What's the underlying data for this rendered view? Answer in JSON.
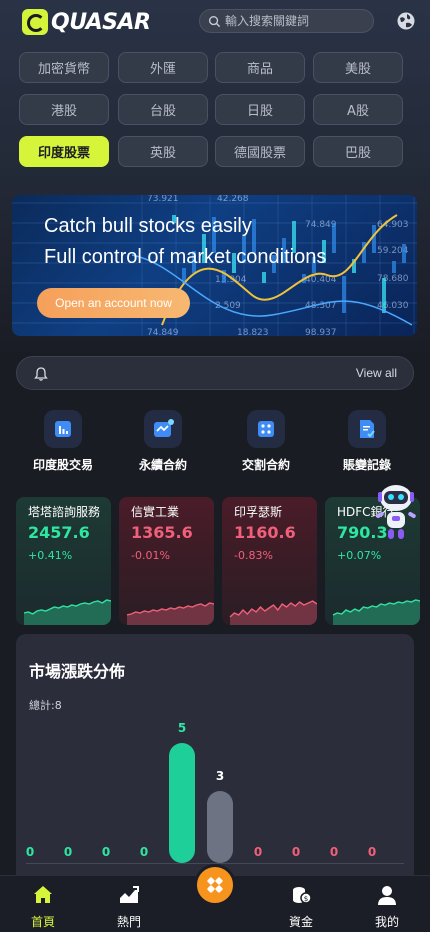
{
  "header": {
    "logo_text": "QUASAR",
    "search_placeholder": "輸入搜索關鍵詞"
  },
  "categories": [
    {
      "label": "加密貨幣",
      "active": false
    },
    {
      "label": "外匯",
      "active": false
    },
    {
      "label": "商品",
      "active": false
    },
    {
      "label": "美股",
      "active": false
    },
    {
      "label": "港股",
      "active": false
    },
    {
      "label": "台股",
      "active": false
    },
    {
      "label": "日股",
      "active": false
    },
    {
      "label": "A股",
      "active": false
    },
    {
      "label": "印度股票",
      "active": true
    },
    {
      "label": "英股",
      "active": false
    },
    {
      "label": "德國股票",
      "active": false
    },
    {
      "label": "巴股",
      "active": false
    }
  ],
  "banner": {
    "line1": "Catch bull stocks easily",
    "line2": "Full control of market conditions",
    "cta": "Open an account now",
    "bg_numbers": [
      "73.921",
      "42.268",
      "64.903",
      "74.849",
      "59.204",
      "40.404",
      "78.680",
      "13.904",
      "2.509",
      "48.307",
      "46.030",
      "74.849",
      "18.823",
      "98.937"
    ]
  },
  "notice": {
    "view_all": "View all"
  },
  "quick_actions": [
    {
      "label": "印度股交易",
      "icon": "chart-bar-icon"
    },
    {
      "label": "永續合約",
      "icon": "trend-icon"
    },
    {
      "label": "交割合約",
      "icon": "dice-icon"
    },
    {
      "label": "賬變記錄",
      "icon": "record-icon"
    }
  ],
  "stock_cards": [
    {
      "name": "塔塔諮詢服務",
      "price": "2457.6",
      "change": "+0.41%",
      "trend": "up",
      "spark": [
        18,
        17,
        19,
        16,
        15,
        16,
        14,
        12,
        13,
        11,
        12,
        10,
        11,
        9,
        8,
        9,
        7,
        6,
        8,
        5,
        6
      ]
    },
    {
      "name": "信實工業",
      "price": "1365.6",
      "change": "-0.01%",
      "trend": "down",
      "spark": [
        20,
        19,
        17,
        18,
        16,
        17,
        15,
        16,
        14,
        15,
        13,
        14,
        12,
        13,
        11,
        12,
        10,
        9,
        11,
        8,
        9
      ]
    },
    {
      "name": "印孚瑟斯",
      "price": "1160.6",
      "change": "-0.83%",
      "trend": "down",
      "spark": [
        22,
        18,
        20,
        15,
        19,
        14,
        17,
        12,
        16,
        13,
        10,
        15,
        9,
        12,
        8,
        11,
        7,
        10,
        8,
        6,
        9
      ]
    },
    {
      "name": "HDFC銀行",
      "price": "790.3",
      "change": "+0.07%",
      "trend": "up",
      "spark": [
        20,
        18,
        19,
        15,
        17,
        14,
        16,
        12,
        13,
        11,
        12,
        9,
        10,
        8,
        9,
        7,
        8,
        6,
        7,
        5,
        6
      ]
    }
  ],
  "distribution": {
    "title": "市場漲跌分佈",
    "total": "總計:8",
    "bars": [
      {
        "value": 0,
        "type": "up"
      },
      {
        "value": 0,
        "type": "up"
      },
      {
        "value": 0,
        "type": "up"
      },
      {
        "value": 0,
        "type": "up"
      },
      {
        "value": 5,
        "type": "up"
      },
      {
        "value": 3,
        "type": "flat"
      },
      {
        "value": 0,
        "type": "down"
      },
      {
        "value": 0,
        "type": "down"
      },
      {
        "value": 0,
        "type": "down"
      },
      {
        "value": 0,
        "type": "down"
      }
    ],
    "max": 5
  },
  "tabbar": [
    {
      "label": "首頁",
      "icon": "home-icon",
      "active": true
    },
    {
      "label": "熱門",
      "icon": "hot-chart-icon",
      "active": false
    },
    {
      "label": "",
      "icon": "trade-center-icon",
      "active": false
    },
    {
      "label": "資金",
      "icon": "coins-icon",
      "active": false
    },
    {
      "label": "我的",
      "icon": "user-icon",
      "active": false
    }
  ],
  "colors": {
    "accent": "#d6f53a",
    "up": "#2ee6a1",
    "down": "#f0607a",
    "flat": "#6e7383",
    "bar_up": "#1fcf9a"
  }
}
